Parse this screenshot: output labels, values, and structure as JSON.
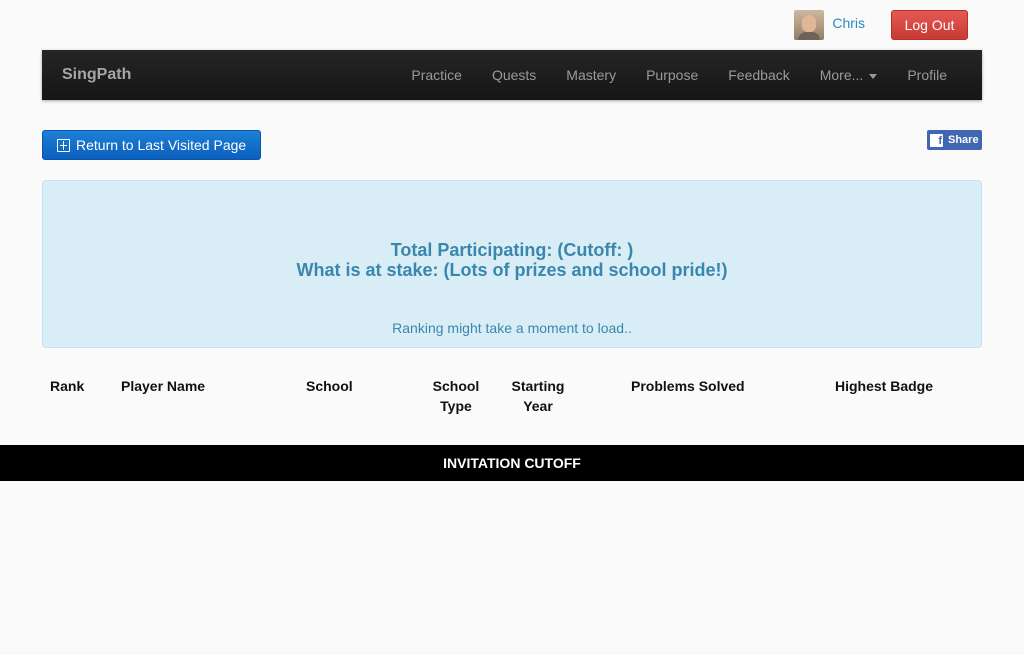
{
  "user": {
    "name": "Chris",
    "logout_label": "Log Out"
  },
  "navbar": {
    "brand": "SingPath",
    "items": [
      {
        "label": "Practice"
      },
      {
        "label": "Quests"
      },
      {
        "label": "Mastery"
      },
      {
        "label": "Purpose"
      },
      {
        "label": "Feedback"
      },
      {
        "label": "More...",
        "dropdown": true
      },
      {
        "label": "Profile"
      }
    ]
  },
  "return_button": {
    "label": "Return to Last Visited Page",
    "icon": "return-icon"
  },
  "share": {
    "label": "Share",
    "icon_text": "f",
    "color": "#4267b2"
  },
  "info": {
    "line1": "Total Participating: (Cutoff: )",
    "line2": "What is at stake: (Lots of prizes and school pride!)",
    "ranking_note": "Ranking might take a moment to load.."
  },
  "table": {
    "columns": [
      {
        "label": "Rank"
      },
      {
        "label": "Player Name"
      },
      {
        "label": "School"
      },
      {
        "label": "School Type"
      },
      {
        "label": "Starting Year"
      },
      {
        "label": "Problems Solved"
      },
      {
        "label": "Highest Badge"
      }
    ],
    "rows": []
  },
  "cutoff": {
    "label": "INVITATION CUTOFF"
  },
  "colors": {
    "accent": "#3a87ad",
    "logout": "#d9534f",
    "primary": "#0b5fbd",
    "navbar": "#1b1b1b"
  }
}
